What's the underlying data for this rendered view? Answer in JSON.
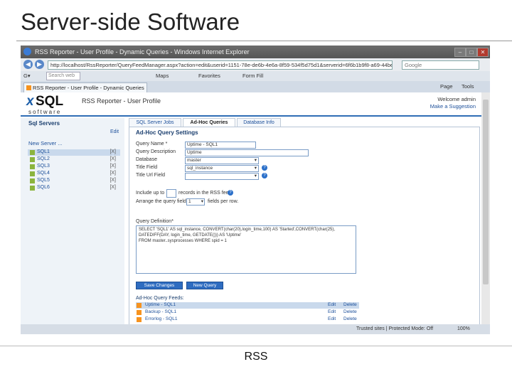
{
  "slide": {
    "title": "Server-side Software",
    "caption": "RSS"
  },
  "browser": {
    "window_title": "RSS Reporter - User Profile - Dynamic Queries - Windows Internet Explorer",
    "address": "http://localhost/RssReporter/QueryFeedManager.aspx?action=edit&userid=1151-78e-de6b-4e6a-8f59-534f5d75d1&serverid=6f6b1b9f8-a69-44be-a27d-1cbb7c",
    "search_engine": "Google",
    "menu_search_placeholder": "Search web",
    "menu_items": [
      "Maps",
      "Favorites",
      "Form Fill"
    ],
    "tab_label": "RSS Reporter - User Profile - Dynamic Queries",
    "tools": [
      "Page",
      "Tools"
    ],
    "status_right": "Trusted sites | Protected Mode: Off",
    "zoom": "100%"
  },
  "app": {
    "logo_x": "x",
    "logo_sql": "SQL",
    "logo_software": "software",
    "title": "RSS Reporter - User Profile",
    "welcome": "Welcome admin",
    "suggestion": "Make a Suggestion"
  },
  "sidebar": {
    "title": "Sql Servers",
    "edit": "Edit",
    "new_server": "New Server ...",
    "servers": [
      {
        "name": "SQL1",
        "x": "[X]"
      },
      {
        "name": "SQL2",
        "x": "[X]"
      },
      {
        "name": "SQL3",
        "x": "[X]"
      },
      {
        "name": "SQL4",
        "x": "[X]"
      },
      {
        "name": "SQL5",
        "x": "[X]"
      },
      {
        "name": "SQL6",
        "x": "[X]"
      }
    ]
  },
  "tabs": [
    "SQL Server Jobs",
    "Ad-Hoc Queries",
    "Database Info"
  ],
  "form": {
    "title": "Ad-Hoc Query Settings",
    "query_name_label": "Query Name *",
    "query_name_value": "Uptime - SQL1",
    "query_desc_label": "Query Description",
    "query_desc_value": "Uptime",
    "database_label": "Database",
    "database_value": "master",
    "title_field_label": "Title Field",
    "title_field_value": "sql_instance",
    "title_url_label": "Title Url Field",
    "include_prefix": "Include up to",
    "include_suffix": "records in the RSS feed.",
    "arrange_prefix": "Arrange the query fields in",
    "arrange_value": "1",
    "arrange_suffix": "fields per row.",
    "query_def_label": "Query Definition*",
    "query_def_value": "SELECT 'SQL1' AS sql_instance, CONVERT(char(20),login_time,100) AS 'Started',CONVERT(char(25),\nDATEDIFF(DAY, login_time, GETDATE())) AS 'Uptime'\nFROM master..sysprocesses WHERE spid = 1",
    "save_btn": "Save Changes",
    "new_btn": "New Query",
    "feeds_label": "Ad-Hoc Query Feeds:",
    "feeds": [
      {
        "name": "Uptime - SQL1",
        "edit": "Edit",
        "del": "Delete"
      },
      {
        "name": "Backup - SQL1",
        "edit": "Edit",
        "del": "Delete"
      },
      {
        "name": "Errorlog - SQL1",
        "edit": "Edit",
        "del": "Delete"
      }
    ]
  }
}
